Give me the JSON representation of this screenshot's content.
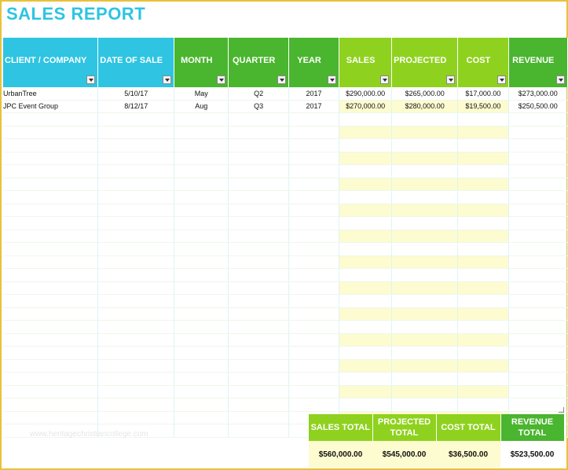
{
  "title": "SALES REPORT",
  "headers": [
    {
      "label": "CLIENT / COMPANY",
      "color": "#2ec4e2"
    },
    {
      "label": "DATE OF SALE",
      "color": "#2ec4e2"
    },
    {
      "label": "MONTH",
      "color": "#4ab52f"
    },
    {
      "label": "QUARTER",
      "color": "#4ab52f"
    },
    {
      "label": "YEAR",
      "color": "#4ab52f"
    },
    {
      "label": "SALES",
      "color": "#8fd11f"
    },
    {
      "label": "PROJECTED",
      "color": "#8fd11f"
    },
    {
      "label": "COST",
      "color": "#8fd11f"
    },
    {
      "label": "REVENUE",
      "color": "#4ab52f"
    }
  ],
  "rows": [
    [
      "UrbanTree",
      "5/10/17",
      "May",
      "Q2",
      "2017",
      "$290,000.00",
      "$265,000.00",
      "$17,000.00",
      "$273,000.00"
    ],
    [
      "JPC Event Group",
      "8/12/17",
      "Aug",
      "Q3",
      "2017",
      "$270,000.00",
      "$280,000.00",
      "$19,500.00",
      "$250,500.00"
    ]
  ],
  "totals": [
    {
      "label": "SALES TOTAL",
      "value": "$560,000.00",
      "color": "#8fd11f"
    },
    {
      "label": "PROJECTED TOTAL",
      "value": "$545,000.00",
      "color": "#8fd11f"
    },
    {
      "label": "COST TOTAL",
      "value": "$36,500.00",
      "color": "#8fd11f"
    },
    {
      "label": "REVENUE TOTAL",
      "value": "$523,500.00",
      "color": "#4ab52f"
    }
  ],
  "watermark": "www.heritagechristiancollege.com"
}
